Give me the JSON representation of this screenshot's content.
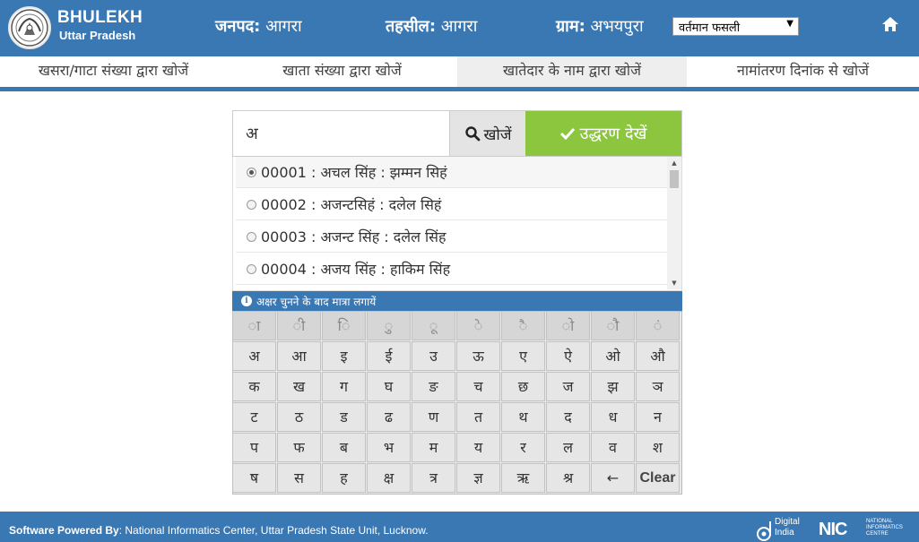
{
  "header": {
    "brand_title": "BHULEKH",
    "brand_subtitle": "Uttar Pradesh",
    "district_label": "जनपद:",
    "district_value": "आगरा",
    "tehsil_label": "तहसील:",
    "tehsil_value": "आगरा",
    "village_label": "ग्राम:",
    "village_value": "अभयपुरा",
    "season_selected": "वर्तमान फसली",
    "home_icon": "home-icon"
  },
  "tabs": [
    {
      "label": "खसरा/गाटा संख्या द्वारा खोजें",
      "active": false
    },
    {
      "label": "खाता संख्या द्वारा खोजें",
      "active": false
    },
    {
      "label": "खातेदार के नाम द्वारा खोजें",
      "active": true
    },
    {
      "label": "नामांतरण दिनांक से खोजें",
      "active": false
    }
  ],
  "search": {
    "value": "अ",
    "search_button": "खोजें",
    "view_button": "उद्धरण देखें"
  },
  "results": [
    {
      "text": "00001 : अचल सिंह : झम्मन सिहं",
      "selected": true
    },
    {
      "text": "00002 : अजन्टसिहं : दलेल सिहं",
      "selected": false
    },
    {
      "text": "00003 : अजन्ट सिंह : दलेल सिंह",
      "selected": false
    },
    {
      "text": "00004 : अजय सिंह : हाकिम सिंह",
      "selected": false
    }
  ],
  "hint": "अक्षर चुनने के बाद मात्रा लगायें",
  "keyboard": {
    "matras": [
      "ा",
      "ी",
      "ि",
      "ु",
      "ू",
      "े",
      "ै",
      "ो",
      "ौ",
      "ं"
    ],
    "rows": [
      [
        "अ",
        "आ",
        "इ",
        "ई",
        "उ",
        "ऊ",
        "ए",
        "ऐ",
        "ओ",
        "औ"
      ],
      [
        "क",
        "ख",
        "ग",
        "घ",
        "ङ",
        "च",
        "छ",
        "ज",
        "झ",
        "ञ"
      ],
      [
        "ट",
        "ठ",
        "ड",
        "ढ",
        "ण",
        "त",
        "थ",
        "द",
        "ध",
        "न"
      ],
      [
        "प",
        "फ",
        "ब",
        "भ",
        "म",
        "य",
        "र",
        "ल",
        "व",
        "श"
      ],
      [
        "ष",
        "स",
        "ह",
        "क्ष",
        "त्र",
        "ज्ञ",
        "ऋ",
        "श्र",
        "←",
        "Clear"
      ]
    ]
  },
  "footer": {
    "powered_label": "Software Powered By",
    "powered_text": ": National Informatics Center, Uttar Pradesh State Unit, Lucknow.",
    "di_line1": "Digital",
    "di_line2": "India",
    "nic": "NIC",
    "nic_sub": "NATIONAL INFORMATICS CENTRE"
  },
  "colors": {
    "header_blue": "#3a78b4",
    "view_green": "#8cc63f"
  }
}
